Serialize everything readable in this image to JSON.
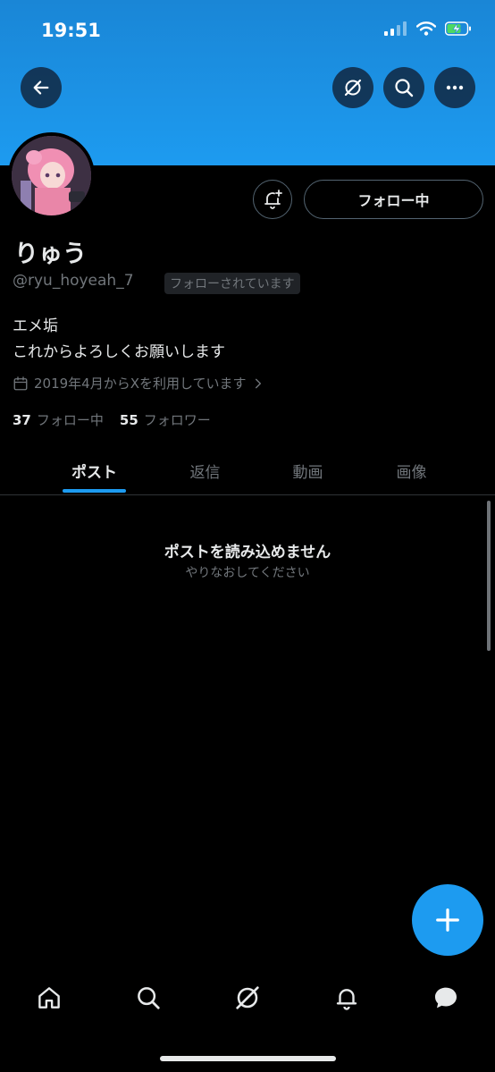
{
  "status_bar": {
    "time": "19:51"
  },
  "profile": {
    "name": "りゅう",
    "handle": "@ryu_hoyeah_7",
    "follows_you": "フォローされています",
    "follow_button": "フォロー中",
    "bio_line1": "エメ垢",
    "bio_line2": "これからよろしくお願いします",
    "joined": "2019年4月からXを利用しています",
    "following_count": "37",
    "following_label": "フォロー中",
    "followers_count": "55",
    "followers_label": "フォロワー"
  },
  "tabs": [
    {
      "label": "ポスト",
      "active": true
    },
    {
      "label": "返信"
    },
    {
      "label": "動画"
    },
    {
      "label": "画像"
    }
  ],
  "empty_state": {
    "title": "ポストを読み込めません",
    "subtitle": "やりなおしてください"
  },
  "icons": {
    "back": "arrow-left-icon",
    "grok": "grok-icon",
    "search": "search-icon",
    "more": "more-icon",
    "notify": "bell-plus-icon",
    "calendar": "calendar-icon",
    "compose": "plus-icon"
  },
  "colors": {
    "accent": "#1d9bf0",
    "background": "#000000",
    "muted": "#71767b"
  }
}
